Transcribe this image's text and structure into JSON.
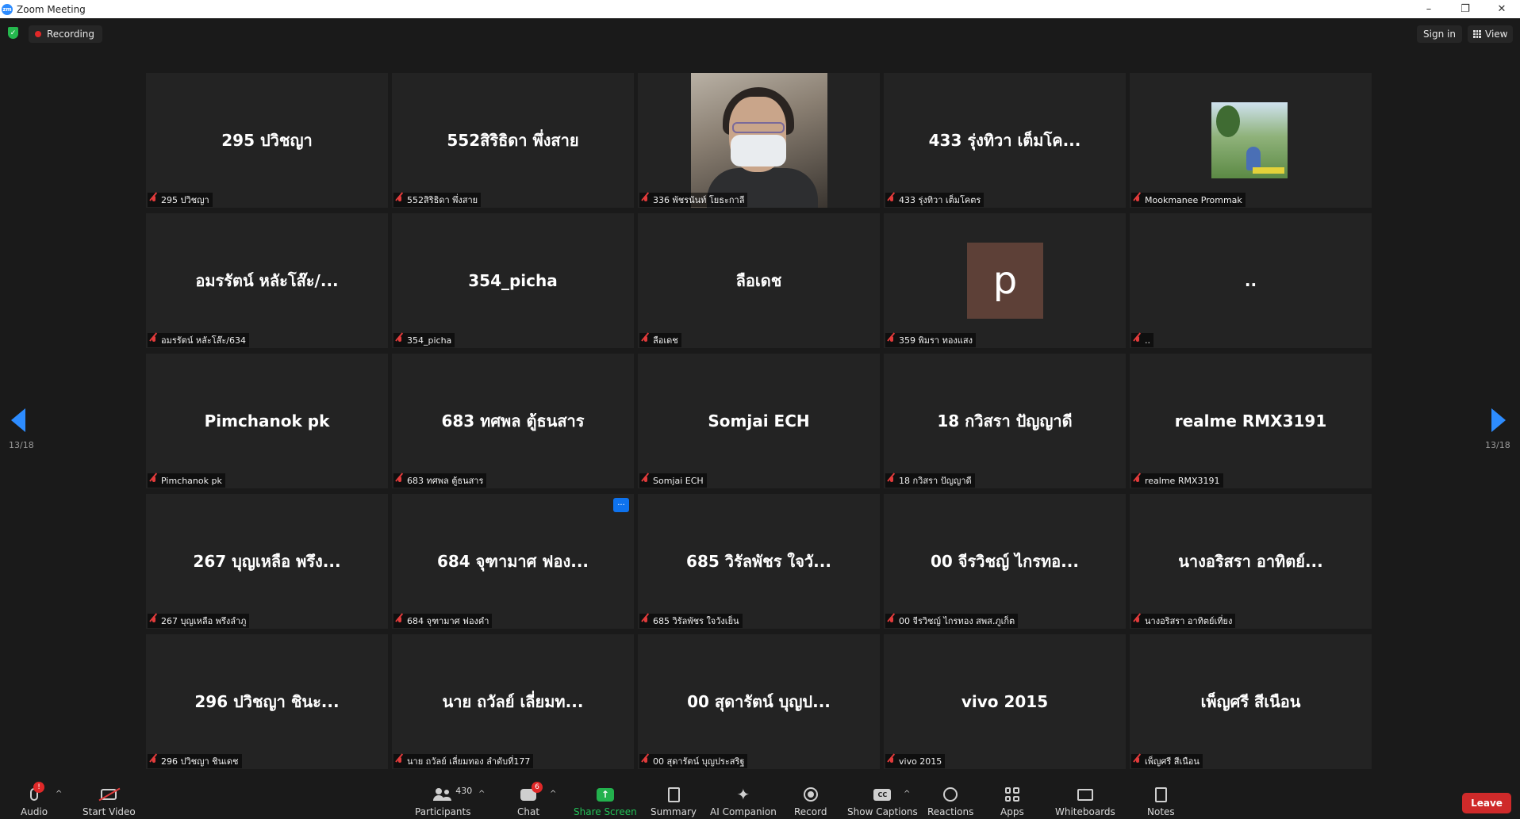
{
  "window": {
    "title": "Zoom Meeting",
    "app_icon": "zm"
  },
  "window_controls": {
    "minimize": "–",
    "restore": "❐",
    "close": "✕"
  },
  "topbar": {
    "recording_label": "Recording",
    "signin_label": "Sign in",
    "view_label": "View"
  },
  "pagination": {
    "left_page": "13/18",
    "right_page": "13/18"
  },
  "tiles": [
    {
      "big": "295 ปวิชญา",
      "label": "295 ปวิชญา"
    },
    {
      "big": "552สิริธิดา พึ่งสาย",
      "label": "552สิริธิดา พึ่งสาย"
    },
    {
      "big": "",
      "label": "336 พัชรนันท์ โยธะกาลี"
    },
    {
      "big": "433 รุ่งทิวา เต็มโค...",
      "label": "433 รุ่งทิวา เต็มโคตร"
    },
    {
      "big": "",
      "label": "Mookmanee Prommak"
    },
    {
      "big": "อมรรัตน์ หลัะโส๊ะ/...",
      "label": "อมรรัตน์ หลัะโส๊ะ/634"
    },
    {
      "big": "354_picha",
      "label": "354_picha"
    },
    {
      "big": "ลือเดช",
      "label": "ลือเดช"
    },
    {
      "big": "",
      "label": "359 พิมรา ทองแสง",
      "avatar_letter": "p"
    },
    {
      "big": "..",
      "label": ".."
    },
    {
      "big": "Pimchanok pk",
      "label": "Pimchanok pk"
    },
    {
      "big": "683 ทศพล ตู้ธนสาร",
      "label": "683 ทศพล ตู้ธนสาร"
    },
    {
      "big": "Somjai ECH",
      "label": "Somjai ECH"
    },
    {
      "big": "18 กวิสรา ปัญญาดี",
      "label": "18 กวิสรา ปัญญาดี"
    },
    {
      "big": "realme RMX3191",
      "label": "realme RMX3191"
    },
    {
      "big": "267 บุญเหลือ พรึง...",
      "label": "267 บุญเหลือ พรึงลำภู"
    },
    {
      "big": "684 จุฑามาศ ฟอง...",
      "label": "684 จุฑามาศ ฟองคำ",
      "more": "···"
    },
    {
      "big": "685 วิรัลพัชร ใจวั...",
      "label": "685 วิรัลพัชร ใจวังเย็น"
    },
    {
      "big": "00 จีรวิชญ์ ไกรทอ...",
      "label": "00 จีรวิชญ์ ไกรทอง สพส.ภูเก็ต"
    },
    {
      "big": "นางอริสรา อาทิตย์...",
      "label": "นางอริสรา อาทิตย์เที่ยง"
    },
    {
      "big": "296 ปวิชญา ชินะ...",
      "label": "296 ปวิชญา ชินเดช"
    },
    {
      "big": "นาย ถวัลย์ เลี่ยมท...",
      "label": "นาย ถวัลย์ เลี่ยมทอง ลำดับที่177"
    },
    {
      "big": "00 สุดารัตน์ บุญป...",
      "label": "00 สุดารัตน์ บุญประสริฐ"
    },
    {
      "big": "vivo 2015",
      "label": "vivo 2015"
    },
    {
      "big": "เพ็ญศรี สีเนือน",
      "label": "เพ็ญศรี สีเนือน"
    }
  ],
  "toolbar": {
    "audio": "Audio",
    "start_video": "Start Video",
    "participants": "Participants",
    "participants_count": "430",
    "chat": "Chat",
    "chat_badge": "6",
    "share_screen": "Share Screen",
    "summary": "Summary",
    "ai_companion": "AI Companion",
    "record": "Record",
    "show_captions": "Show Captions",
    "cc_text": "CC",
    "reactions": "Reactions",
    "apps": "Apps",
    "whiteboards": "Whiteboards",
    "notes": "Notes",
    "leave": "Leave",
    "audio_badge": "!"
  }
}
